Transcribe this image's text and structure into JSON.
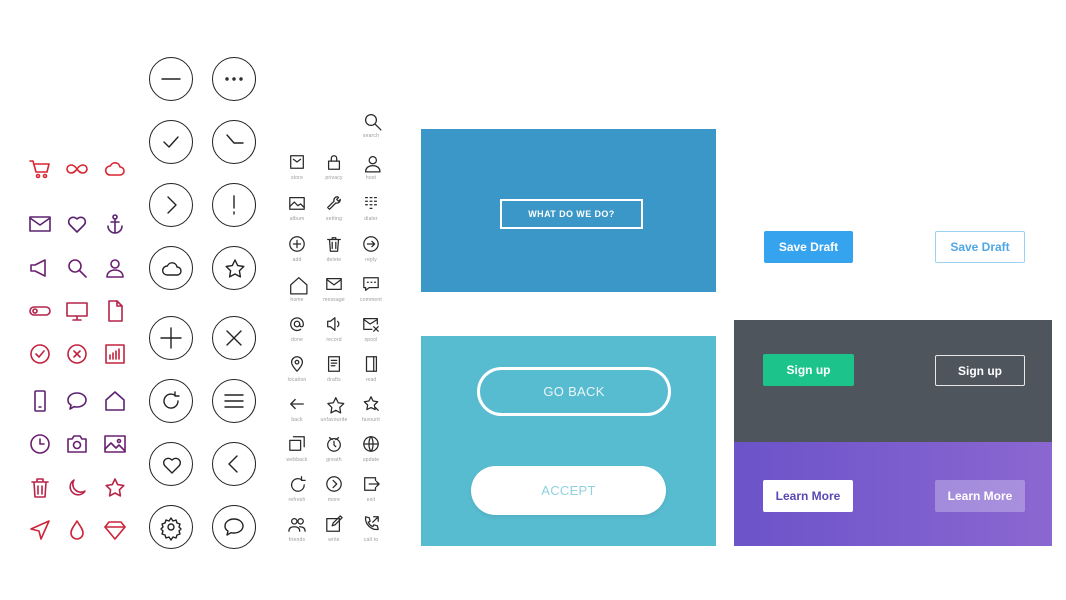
{
  "colors": {
    "icon_gradient_top": "#e0242e",
    "icon_gradient_bottom": "#4a1f7a",
    "blue_panel": "#3b97c7",
    "teal_panel": "#58bcd0",
    "dark_panel": "#4f555c",
    "purple_panel_start": "#6b53c9",
    "purple_panel_end": "#8b67d1",
    "save_blue": "#36a3ef",
    "signup_green": "#1cc48b"
  },
  "line_icons": [
    "cart-icon",
    "infinity-icon",
    "cloud-icon",
    "mail-icon",
    "heart-icon",
    "anchor-icon",
    "megaphone-icon",
    "search-icon",
    "user-icon",
    "toggle-icon",
    "monitor-icon",
    "document-icon",
    "check-circle-icon",
    "x-circle-icon",
    "bar-chart-icon",
    "phone-icon",
    "chat-bubble-icon",
    "home-icon",
    "clock-icon",
    "camera-icon",
    "image-icon",
    "trash-icon",
    "moon-icon",
    "star-icon",
    "send-icon",
    "drop-icon",
    "diamond-icon"
  ],
  "circle_icons": [
    "minus-icon",
    "more-icon",
    "check-icon",
    "clock-hands-icon",
    "chevron-right-icon",
    "exclamation-icon",
    "cloud-icon",
    "star-icon",
    "plus-icon",
    "close-icon",
    "refresh-icon",
    "menu-icon",
    "heart-icon",
    "chevron-left-icon",
    "settings-icon",
    "chat-icon"
  ],
  "small_icons": [
    {
      "icon": "search-icon",
      "label": "search"
    },
    {
      "icon": "save-icon",
      "label": "store"
    },
    {
      "icon": "lock-icon",
      "label": "privacy"
    },
    {
      "icon": "user-icon",
      "label": "host"
    },
    {
      "icon": "album-icon",
      "label": "album"
    },
    {
      "icon": "wrench-icon",
      "label": "setting"
    },
    {
      "icon": "keypad-icon",
      "label": "dialer"
    },
    {
      "icon": "add-icon",
      "label": "add"
    },
    {
      "icon": "delete-icon",
      "label": "delete"
    },
    {
      "icon": "forward-icon",
      "label": "reply"
    },
    {
      "icon": "home-icon",
      "label": "home"
    },
    {
      "icon": "message-icon",
      "label": "message"
    },
    {
      "icon": "comment-icon",
      "label": "comment"
    },
    {
      "icon": "at-icon",
      "label": "done"
    },
    {
      "icon": "volume-icon",
      "label": "record"
    },
    {
      "icon": "mail-x-icon",
      "label": "spool"
    },
    {
      "icon": "location-icon",
      "label": "location"
    },
    {
      "icon": "drafts-icon",
      "label": "drafts"
    },
    {
      "icon": "read-icon",
      "label": "read"
    },
    {
      "icon": "back-icon",
      "label": "back"
    },
    {
      "icon": "star-icon",
      "label": "unfavourite"
    },
    {
      "icon": "favourite-icon",
      "label": "favourit"
    },
    {
      "icon": "stack-icon",
      "label": "webback"
    },
    {
      "icon": "timer-icon",
      "label": "greath"
    },
    {
      "icon": "globe-icon",
      "label": "update"
    },
    {
      "icon": "refresh-icon",
      "label": "refresh"
    },
    {
      "icon": "next-icon",
      "label": "more"
    },
    {
      "icon": "exit-icon",
      "label": "exit"
    },
    {
      "icon": "people-icon",
      "label": "friends"
    },
    {
      "icon": "edit-icon",
      "label": "write"
    },
    {
      "icon": "call-icon",
      "label": "call to"
    }
  ],
  "buttons": {
    "what_we_do": "WHAT DO WE DO?",
    "go_back": "GO BACK",
    "accept": "ACCEPT",
    "save_draft_solid": "Save Draft",
    "save_draft_outline": "Save Draft",
    "sign_up_solid": "Sign up",
    "sign_up_outline": "Sign up",
    "learn_more_solid": "Learn More",
    "learn_more_ghost": "Learn More"
  }
}
